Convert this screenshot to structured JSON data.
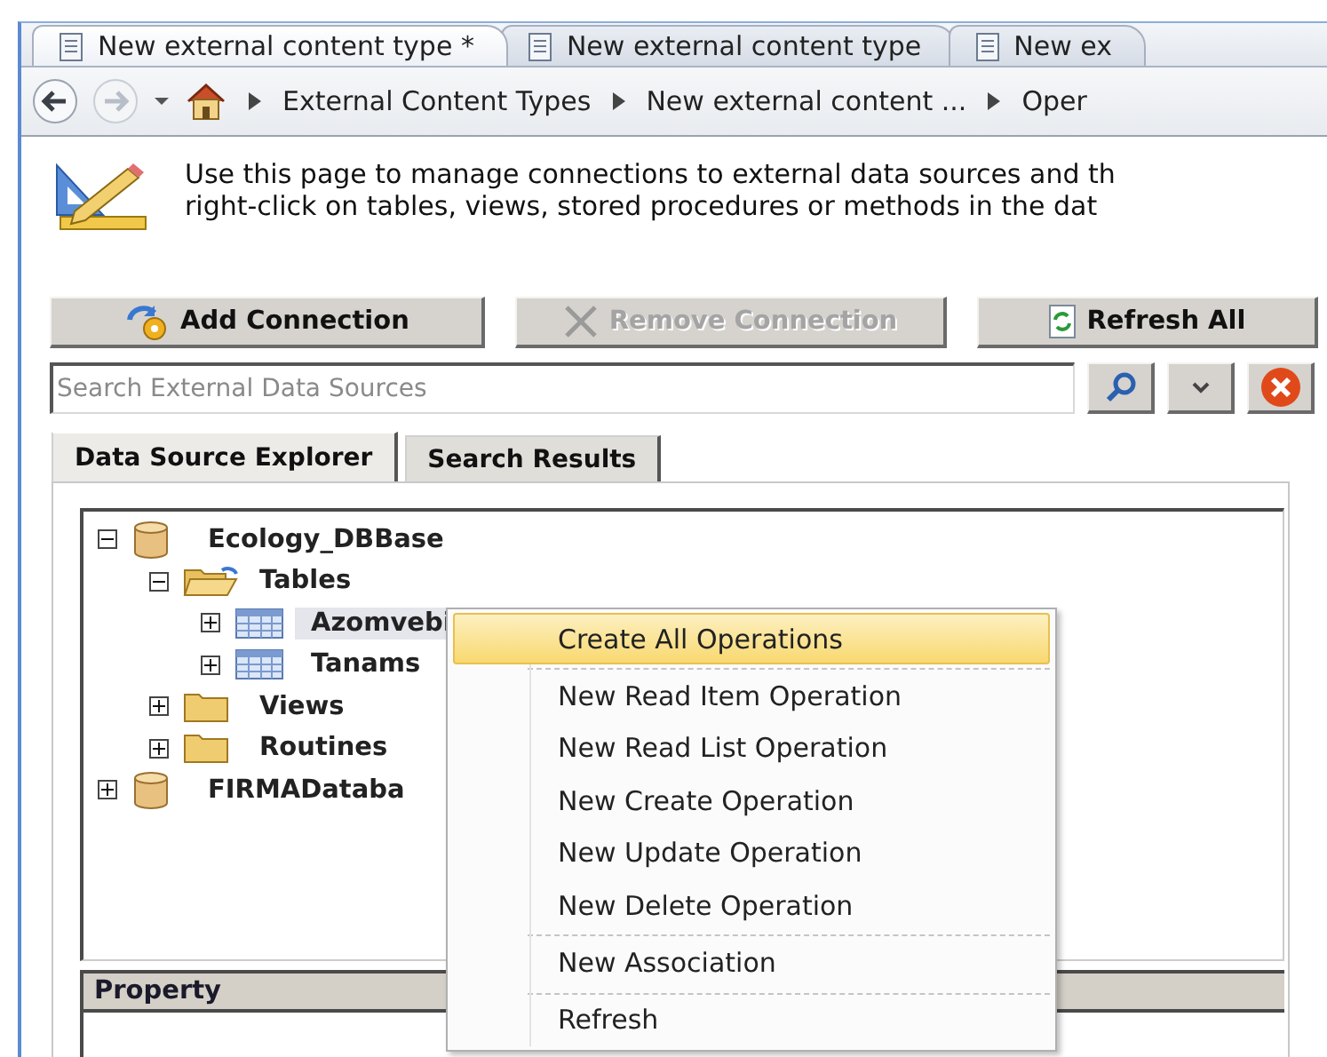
{
  "tabs": [
    {
      "label": "New external content type *",
      "selected": true
    },
    {
      "label": "New external content type",
      "selected": false
    },
    {
      "label": "New ex",
      "selected": false
    }
  ],
  "breadcrumb": {
    "items": [
      "External Content Types",
      "New external content ...",
      "Oper"
    ]
  },
  "info": {
    "lines": [
      "Use this page to manage connections to external data sources and th",
      "right-click on tables, views, stored procedures or methods in the dat"
    ]
  },
  "toolbar": [
    {
      "label": "Add Connection",
      "kind": "connection",
      "disabled": false
    },
    {
      "label": "Remove Connection",
      "kind": "remove",
      "disabled": true
    },
    {
      "label": "Refresh All",
      "kind": "refresh",
      "disabled": false
    }
  ],
  "search": {
    "placeholder": "Search External Data Sources"
  },
  "panel_tabs": [
    {
      "label": "Data Source Explorer",
      "selected": true
    },
    {
      "label": "Search Results",
      "selected": false
    }
  ],
  "tree": [
    {
      "label": "Ecology_DBBase",
      "kind": "database",
      "expanded": true,
      "selected": false,
      "children": [
        {
          "label": "Tables",
          "kind": "folder-open",
          "expanded": true,
          "selected": false,
          "children": [
            {
              "label": "Azomvebi",
              "kind": "table",
              "expanded": false,
              "selected": true
            },
            {
              "label": "Tanams",
              "kind": "table",
              "expanded": false,
              "selected": false
            }
          ]
        },
        {
          "label": "Views",
          "kind": "folder",
          "expanded": false,
          "selected": false
        },
        {
          "label": "Routines",
          "kind": "folder",
          "expanded": false,
          "selected": false
        }
      ]
    },
    {
      "label": "FIRMADataba",
      "kind": "database",
      "expanded": false,
      "selected": false
    }
  ],
  "property_grid": {
    "columns": [
      "Property"
    ]
  },
  "context_menu": {
    "groups": [
      [
        {
          "label": "Create All Operations",
          "selected": true
        }
      ],
      [
        {
          "label": "New Read Item Operation",
          "selected": false
        },
        {
          "label": "New Read List Operation",
          "selected": false
        },
        {
          "label": "New Create Operation",
          "selected": false
        },
        {
          "label": "New Update Operation",
          "selected": false
        },
        {
          "label": "New Delete Operation",
          "selected": false
        }
      ],
      [
        {
          "label": "New Association",
          "selected": false
        }
      ],
      [
        {
          "label": "Refresh",
          "selected": false
        }
      ]
    ]
  }
}
